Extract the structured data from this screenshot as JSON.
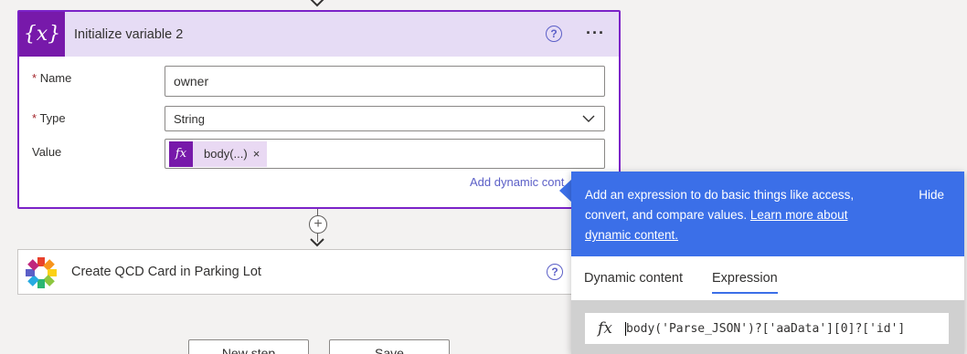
{
  "card1": {
    "icon_text": "{x}",
    "title": "Initialize variable 2",
    "help_icon": "?",
    "more_icon": "···",
    "fields": {
      "name_label": "Name",
      "name_value": "owner",
      "type_label": "Type",
      "type_value": "String",
      "value_label": "Value",
      "token_fx": "fx",
      "token_label": "body(...)",
      "token_close": "×"
    },
    "required_mark": "*",
    "add_dynamic": "Add dynamic cont"
  },
  "connector": {
    "plus": "+"
  },
  "card2": {
    "title": "Create QCD Card in Parking Lot",
    "help_icon": "?"
  },
  "bottom_buttons": [
    "New step",
    "Save"
  ],
  "flyout": {
    "description": "Add an expression to do basic things like access, convert, and compare values.",
    "link_line1": "Learn more about",
    "link_line2": "dynamic content.",
    "hide_label": "Hide",
    "tabs": [
      "Dynamic content",
      "Expression"
    ],
    "active_tab": "Expression",
    "expr_fx": "fx",
    "expression": "body('Parse_JSON')?['aaData'][0]?['id']"
  },
  "colors": {
    "accent_purple": "#7719aa",
    "card_border": "#7b22c8",
    "header_bg": "#e6dcf5",
    "flyout_blue": "#3b6fe8",
    "link_blue": "#5b5fc7"
  }
}
